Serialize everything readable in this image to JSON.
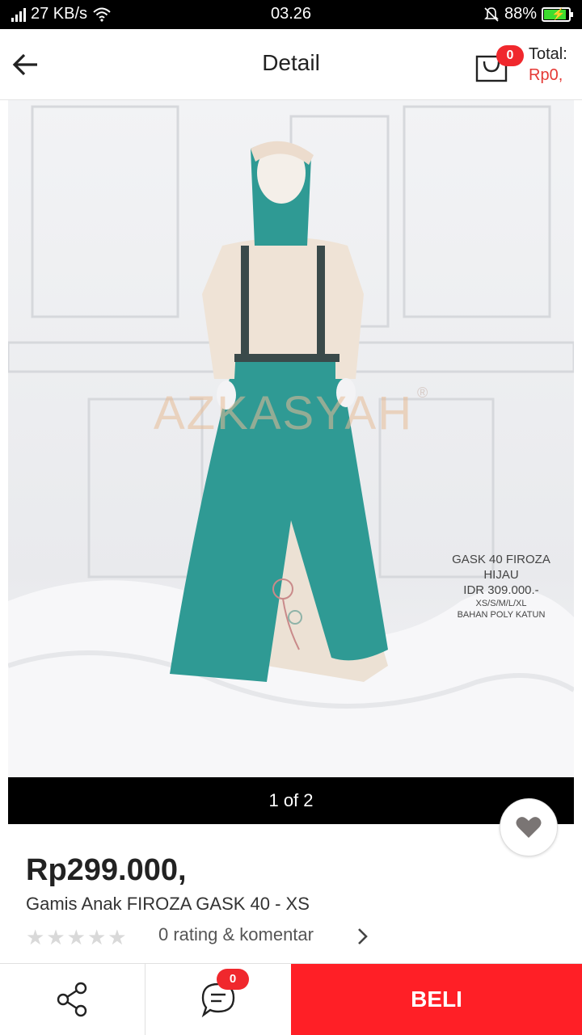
{
  "status_bar": {
    "network_speed": "27 KB/s",
    "time": "03.26",
    "battery": "88%",
    "icons": [
      "signal-icon",
      "wifi-icon",
      "mute-bell-icon",
      "battery-charging-icon"
    ]
  },
  "header": {
    "title": "Detail",
    "cart_count": "0",
    "total_label": "Total:",
    "total_value": "Rp0,"
  },
  "gallery": {
    "counter": "1 of 2",
    "watermark": "AZKASYAH",
    "watermark_mark": "®",
    "caption": {
      "line1": "GASK 40 FIROZA",
      "line2": "HIJAU",
      "line3": "IDR 309.000.-",
      "line4": "XS/S/M/L/XL",
      "line5": "BAHAN POLY KATUN"
    }
  },
  "product": {
    "price": "Rp299.000,",
    "name": "Gamis Anak FIROZA GASK 40 - XS",
    "rating_stars": 0,
    "rating_max": 5,
    "rating_text": "0 rating & komentar"
  },
  "bottom_bar": {
    "comment_count": "0",
    "buy_label": "BELI"
  },
  "colors": {
    "accent": "#ff1f26",
    "badge": "#f0282d",
    "total_value": "#e53935",
    "star_empty": "#d9d9d9"
  }
}
